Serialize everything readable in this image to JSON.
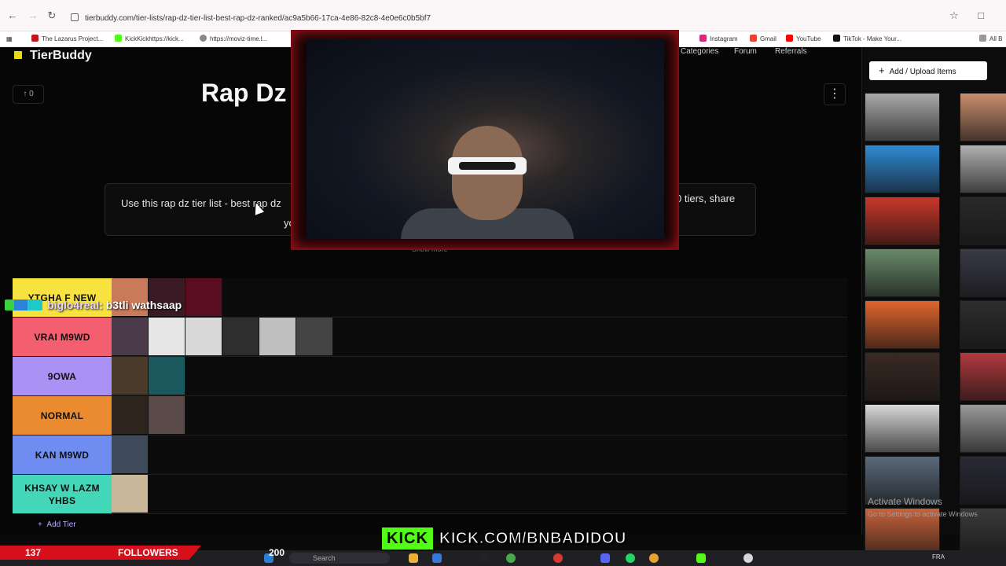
{
  "browser": {
    "url": "tierbuddy.com/tier-lists/rap-dz-tier-list-best-rap-dz-ranked/ac9a5b66-17ca-4e86-82c8-4e0e6c0b5bf7",
    "bookmarks": [
      "The Lazarus Project...",
      "KickKickhttps://kick...",
      "https://moviz-time.l...",
      "Instagram",
      "Gmail",
      "YouTube",
      "TikTok - Make Your...",
      "All B"
    ]
  },
  "site": {
    "logo": "TierBuddy",
    "nav": [
      "Categories",
      "Forum",
      "Referrals"
    ],
    "upvotes": "0",
    "title": "Rap Dz T",
    "description": "Use this rap dz tier list - best rap dz",
    "description_tail": "0 tiers, share",
    "description_line2": "yo",
    "show_more": "Show more",
    "add_tier": "Add Tier",
    "upload_button": "Add / Upload Items"
  },
  "tiers": [
    {
      "label": "YTGHA F NEW",
      "color": "#f7e23f",
      "tiles": [
        "#c97a5a",
        "#3a1a24",
        "#5a0d1e"
      ]
    },
    {
      "label": "VRAI M9WD",
      "color": "#f35f6e",
      "tiles": [
        "#4a3a4a",
        "#e6e6e6",
        "#d8d8d8",
        "#2e2e2e",
        "#bfbfbf",
        "#444"
      ]
    },
    {
      "label": "9OWA",
      "color": "#a992f3",
      "tiles": [
        "#4a3a2a",
        "#1a5a5e"
      ]
    },
    {
      "label": "NORMAL",
      "color": "#ea8b2f",
      "tiles": [
        "#2e241e",
        "#5a4a4a"
      ]
    },
    {
      "label": "KAN M9WD",
      "color": "#6f8df0",
      "tiles": [
        "#3e4a5a"
      ]
    },
    {
      "label": "KHSAY W LAZM YHBS",
      "color": "#44d6b8",
      "tiles": [
        "#c9b79a"
      ]
    }
  ],
  "pool": {
    "tiles": [
      "#a9a9a9",
      "#c98e6e",
      "#2e8bd6",
      "#b0b0b0",
      "#c8372a",
      "#2a2a2a",
      "#6a8a6a",
      "#3a3a48",
      "#e0662e",
      "#2e2e2e",
      "#3a2a24",
      "#b03a3e",
      "#d8d8d8",
      "#9a9a9a",
      "#5a6a7a",
      "#2a2a36",
      "#c8623a",
      "#3a3a3a"
    ]
  },
  "stream": {
    "chat_user": "biglo4real",
    "chat_message": ": b3tli wathsaap",
    "followers_count": "137",
    "followers_label": "FOLLOWERS",
    "followers_goal": "200",
    "kick_logo": "KICK",
    "kick_url": "KICK.COM/BNBADIDOU"
  },
  "os": {
    "search": "Search",
    "lang": "FRA",
    "watermark_title": "Activate Windows",
    "watermark_sub": "Go to Settings to activate Windows"
  }
}
